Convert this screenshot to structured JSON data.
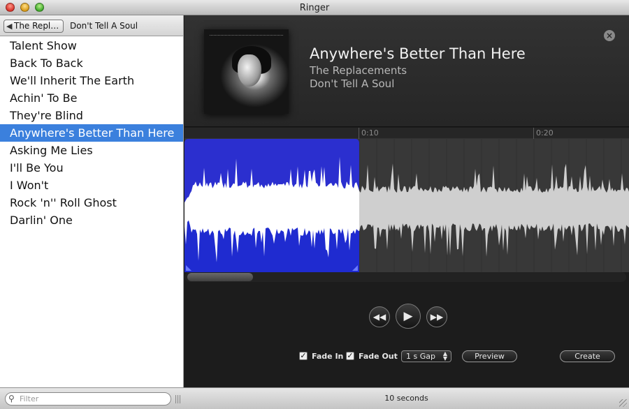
{
  "window": {
    "title": "Ringer"
  },
  "breadcrumb": {
    "back_label": "The Repl…",
    "current": "Don't Tell A Soul"
  },
  "tracks": [
    "Talent Show",
    "Back To Back",
    "We'll Inherit The Earth",
    "Achin' To Be",
    "They're Blind",
    "Anywhere's Better Than Here",
    "Asking Me Lies",
    "I'll Be You",
    "I Won't",
    "Rock 'n'' Roll Ghost",
    "Darlin' One"
  ],
  "selected_track": "Anywhere's Better Than Here",
  "now_playing": {
    "title": "Anywhere's Better Than Here",
    "artist": "The Replacements",
    "album": "Don't Tell A Soul"
  },
  "timeline": {
    "ticks": [
      "0:10",
      "0:20"
    ]
  },
  "selection": {
    "start_fraction": 0.0,
    "end_fraction": 0.393
  },
  "scroll": {
    "position_fraction": 0.0,
    "visible_fraction": 0.15
  },
  "transport": {
    "rewind_icon": "rewind-icon",
    "play_icon": "play-icon",
    "forward_icon": "fast-forward-icon"
  },
  "options": {
    "fade_in_label": "Fade In",
    "fade_in_checked": true,
    "fade_out_label": "Fade Out",
    "fade_out_checked": true,
    "gap_value": "1 s Gap",
    "preview_label": "Preview",
    "create_label": "Create"
  },
  "search": {
    "placeholder": "Filter"
  },
  "status": {
    "text": "10 seconds"
  },
  "colors": {
    "selection_blue": "#3b80dd",
    "wave_selected_bg": "#2b2fcf",
    "wave_bg": "#383838",
    "wave_fill": "#cfcfcf"
  }
}
